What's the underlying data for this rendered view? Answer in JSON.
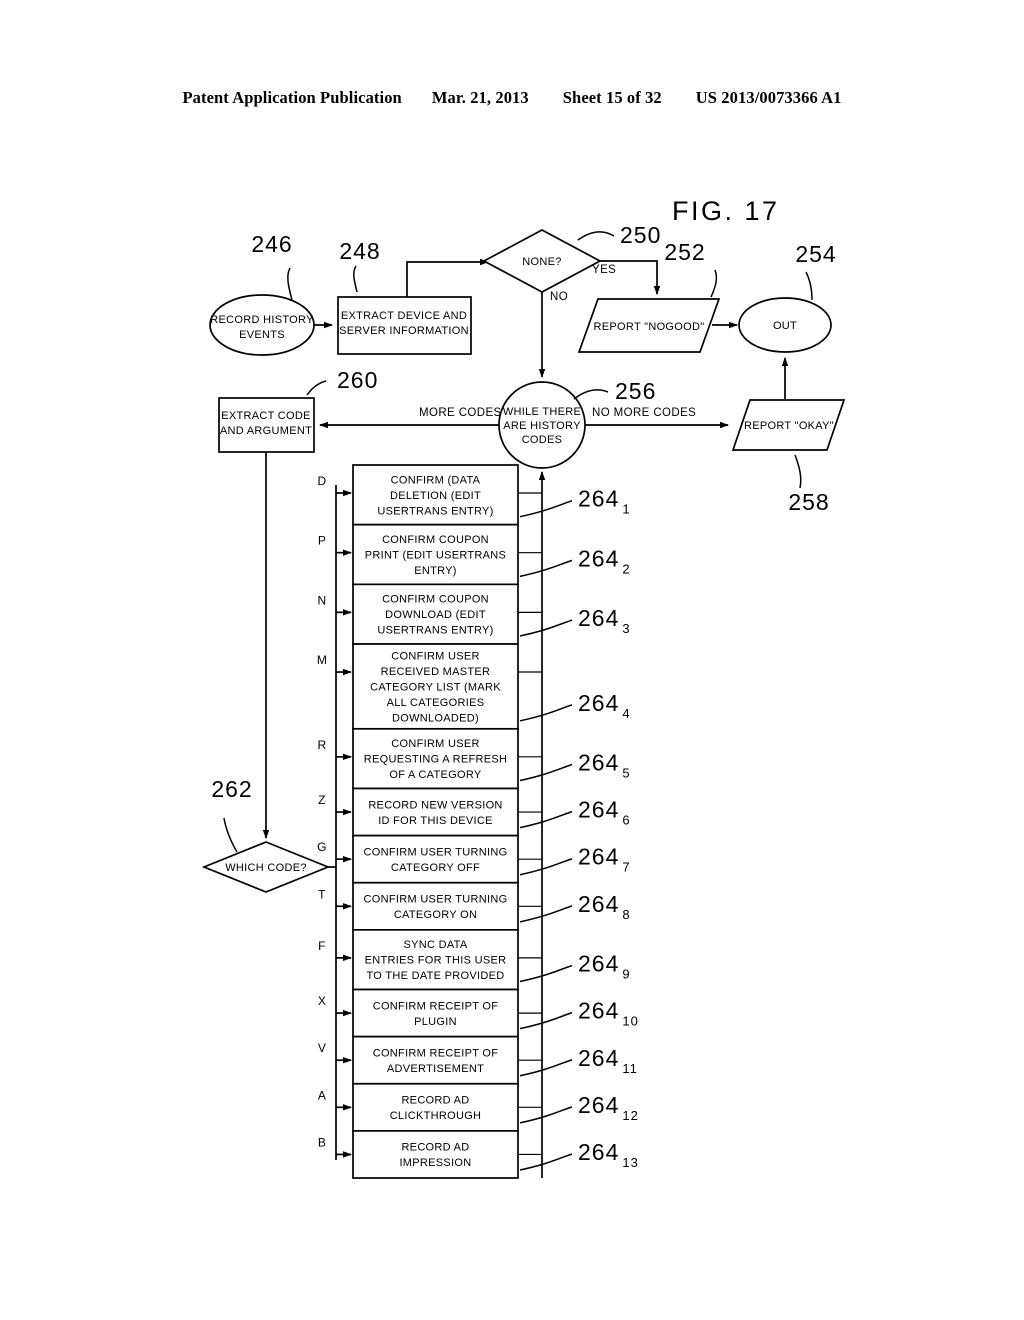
{
  "header": {
    "publication": "Patent Application Publication",
    "date": "Mar. 21, 2013",
    "sheet": "Sheet 15 of 32",
    "number": "US 2013/0073366 A1"
  },
  "figure": {
    "title": "FIG. 17"
  },
  "nodes": {
    "start": {
      "ref": "246",
      "label_line1": "RECORD HISTORY",
      "label_line2": "EVENTS",
      "shape": "ellipse"
    },
    "extract_info": {
      "ref": "248",
      "label_line1": "EXTRACT DEVICE AND",
      "label_line2": "SERVER INFORMATION",
      "shape": "rect"
    },
    "none_decision": {
      "ref": "250",
      "label": "NONE?",
      "shape": "diamond"
    },
    "report_nogood": {
      "ref": "252",
      "label": "REPORT \"NOGOOD\"",
      "shape": "parallelogram"
    },
    "out": {
      "ref": "254",
      "label": "OUT",
      "shape": "ellipse"
    },
    "while_loop": {
      "ref": "256",
      "label_line1": "WHILE THERE",
      "label_line2": "ARE HISTORY",
      "label_line3": "CODES",
      "shape": "circle"
    },
    "report_okay": {
      "ref": "258",
      "label": "REPORT \"OKAY\"",
      "shape": "parallelogram"
    },
    "extract_code": {
      "ref": "260",
      "label_line1": "EXTRACT CODE",
      "label_line2": "AND ARGUMENT",
      "shape": "rect"
    },
    "which_code": {
      "ref": "262",
      "label": "WHICH CODE?",
      "shape": "diamond"
    }
  },
  "edge_labels": {
    "yes": "YES",
    "no": "NO",
    "more_codes": "MORE CODES",
    "no_more_codes": "NO MORE CODES"
  },
  "action_boxes": [
    {
      "code": "D",
      "ref_base": "264",
      "ref_sub": "1",
      "lines": [
        "CONFIRM (DATA",
        "DELETION (EDIT",
        "USERTRANS ENTRY)"
      ]
    },
    {
      "code": "P",
      "ref_base": "264",
      "ref_sub": "2",
      "lines": [
        "CONFIRM COUPON",
        "PRINT (EDIT USERTRANS",
        "ENTRY)"
      ]
    },
    {
      "code": "N",
      "ref_base": "264",
      "ref_sub": "3",
      "lines": [
        "CONFIRM COUPON",
        "DOWNLOAD (EDIT",
        "USERTRANS ENTRY)"
      ]
    },
    {
      "code": "M",
      "ref_base": "264",
      "ref_sub": "4",
      "lines": [
        "CONFIRM USER",
        "RECEIVED MASTER",
        "CATEGORY LIST (MARK",
        "ALL CATEGORIES",
        "DOWNLOADED)"
      ]
    },
    {
      "code": "R",
      "ref_base": "264",
      "ref_sub": "5",
      "lines": [
        "CONFIRM USER",
        "REQUESTING A REFRESH",
        "OF A CATEGORY"
      ]
    },
    {
      "code": "Z",
      "ref_base": "264",
      "ref_sub": "6",
      "lines": [
        "RECORD NEW VERSION",
        "ID FOR THIS DEVICE"
      ]
    },
    {
      "code": "G",
      "ref_base": "264",
      "ref_sub": "7",
      "lines": [
        "CONFIRM USER TURNING",
        "CATEGORY OFF"
      ]
    },
    {
      "code": "T",
      "ref_base": "264",
      "ref_sub": "8",
      "lines": [
        "CONFIRM USER TURNING",
        "CATEGORY ON"
      ]
    },
    {
      "code": "F",
      "ref_base": "264",
      "ref_sub": "9",
      "lines": [
        "SYNC DATA",
        "ENTRIES FOR THIS USER",
        "TO THE DATE PROVIDED"
      ]
    },
    {
      "code": "X",
      "ref_base": "264",
      "ref_sub": "10",
      "lines": [
        "CONFIRM RECEIPT OF",
        "PLUGIN"
      ]
    },
    {
      "code": "V",
      "ref_base": "264",
      "ref_sub": "11",
      "lines": [
        "CONFIRM RECEIPT OF",
        "ADVERTISEMENT"
      ]
    },
    {
      "code": "A",
      "ref_base": "264",
      "ref_sub": "12",
      "lines": [
        "RECORD AD",
        "CLICKTHROUGH"
      ]
    },
    {
      "code": "B",
      "ref_base": "264",
      "ref_sub": "13",
      "lines": [
        "RECORD AD",
        "IMPRESSION"
      ]
    }
  ],
  "colors": {
    "ink": "#000000",
    "paper": "#ffffff"
  }
}
